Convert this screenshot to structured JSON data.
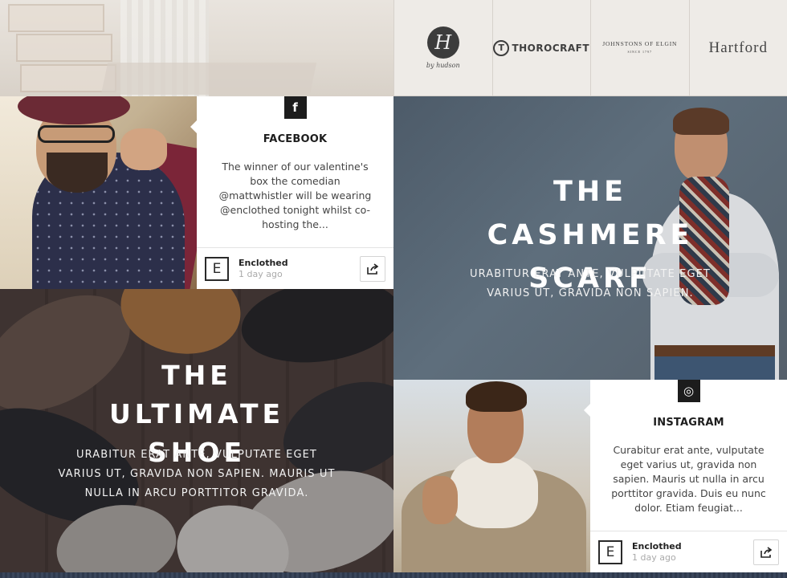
{
  "brands": {
    "hudson": {
      "letter": "H",
      "sub": "by hudson"
    },
    "thorocraft": {
      "letter": "T",
      "name": "THOROCRAFT"
    },
    "johnstons": {
      "name": "JOHNSTONS OF ELGIN",
      "since": "SINCE 1797"
    },
    "hartford": {
      "name": "Hartford"
    }
  },
  "facebook_card": {
    "badge": "f",
    "title": "FACEBOOK",
    "text": "The winner of our valentine's box the comedian @mattwhistler will be wearing @enclothed tonight whilst co-hosting the...",
    "avatar": "E",
    "author": "Enclothed",
    "time": "1 day ago"
  },
  "scarf_hero": {
    "title": "THE CASHMERE SCARF",
    "subtitle": "URABITUR ERAT ANTE, VULPUTATE EGET VARIUS UT, GRAVIDA NON SAPIEN."
  },
  "shoe_hero": {
    "title": "THE ULTIMATE SHOE",
    "subtitle": "URABITUR ERAT ANTE, VULPUTATE EGET VARIUS UT, GRAVIDA NON SAPIEN. MAURIS UT NULLA IN ARCU PORTTITOR GRAVIDA."
  },
  "instagram_card": {
    "badge": "◎",
    "title": "INSTAGRAM",
    "text": "Curabitur erat ante, vulputate eget varius ut, gravida non sapien. Mauris ut nulla in arcu porttitor gravida. Duis eu nunc dolor. Etiam feugiat...",
    "avatar": "E",
    "author": "Enclothed",
    "time": "1 day ago"
  }
}
